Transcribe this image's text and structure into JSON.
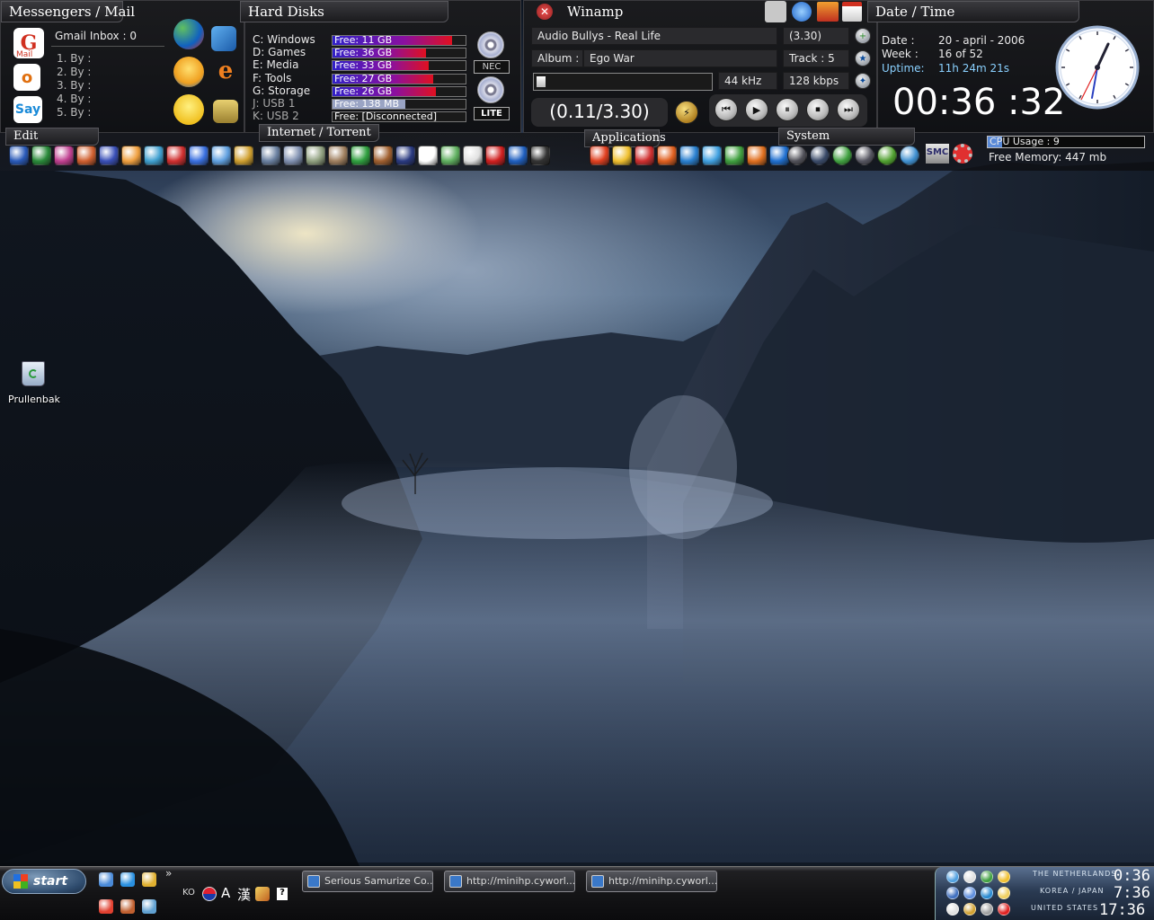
{
  "messengers": {
    "title": "Messengers / Mail",
    "inbox": "Gmail Inbox : 0",
    "items": [
      "1. By :",
      "2. By :",
      "3. By :",
      "4. By :",
      "5. By :"
    ],
    "gmail_label": "Mail",
    "skype_label": "Say"
  },
  "disks": {
    "title": "Hard Disks",
    "drives": [
      {
        "name": "C: Windows",
        "free": "Free: 11   GB",
        "percent_free": 10
      },
      {
        "name": "D: Games",
        "free": "Free: 36   GB",
        "percent_free": 30
      },
      {
        "name": "E: Media",
        "free": "Free: 33   GB",
        "percent_free": 28
      },
      {
        "name": "F: Tools",
        "free": "Free: 27   GB",
        "percent_free": 24
      },
      {
        "name": "G: Storage",
        "free": "Free: 26   GB",
        "percent_free": 22
      },
      {
        "name": "J: USB 1",
        "free": "Free: 138  MB",
        "percent_free": 55
      },
      {
        "name": "K: USB 2",
        "free": "Free: [Disconnected]",
        "percent_free": 0
      }
    ],
    "drive_label_1": "NEC",
    "drive_label_2": "LITE"
  },
  "winamp": {
    "title": "Winamp",
    "song": "Audio Bullys - Real Life",
    "length": "(3.30)",
    "album_label": "Album :",
    "album": "Ego War",
    "track": "Track : 5",
    "khz": "44 kHz",
    "kbps": "128 kbps",
    "position": "(0.11/3.30)",
    "progress_fraction": 0.05
  },
  "datetime": {
    "title": "Date / Time",
    "date_label": "Date :",
    "date_value": "20 - april - 2006",
    "week_label": "Week  :",
    "week_value": "16 of 52",
    "uptime_label": "Uptime:",
    "uptime_value": "11h 24m 21s",
    "time": "00:36 :32"
  },
  "toolbars": {
    "edit": "Edit",
    "internet": "Internet / Torrent",
    "applications": "Applications",
    "system": "System",
    "cpu": "CPU Usage : 9",
    "memory": "Free Memory: 447 mb",
    "smc": "SMC"
  },
  "desktop": {
    "recycle_bin": "Prullenbak"
  },
  "taskbar": {
    "start": "start",
    "chevron": "»",
    "lang": "KO",
    "ime_a": "A",
    "ime_han": "漢",
    "tasks": [
      "Serious Samurize Co...",
      "http://minihp.cyworl...",
      "http://minihp.cyworl..."
    ],
    "clocks": [
      {
        "zone": "THE NETHERLANDS",
        "time": "0:36"
      },
      {
        "zone": "KOREA / JAPAN",
        "time": "7:36"
      },
      {
        "zone": "UNITED STATES",
        "time": "17:36"
      }
    ]
  },
  "colors": {
    "disk_gradient_start": "#3020c8",
    "disk_gradient_end": "#e01020",
    "uptime": "#8ad0ff"
  }
}
